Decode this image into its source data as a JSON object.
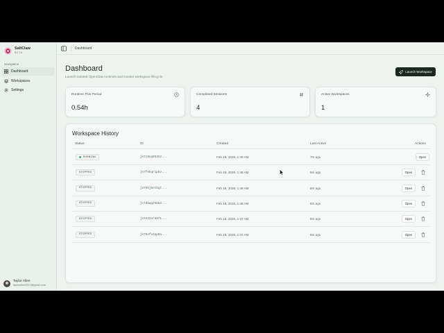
{
  "brand": {
    "name": "SaltClaw",
    "tag": "BETA"
  },
  "sidebar": {
    "section_label": "Navigation",
    "items": [
      {
        "label": "Dashboard",
        "icon": "dashboard-icon",
        "active": true
      },
      {
        "label": "Workspaces",
        "icon": "layers-icon",
        "active": false
      },
      {
        "label": "Settings",
        "icon": "gear-icon",
        "active": false
      }
    ]
  },
  "user": {
    "name": "Taylor Allen",
    "email": "taylorallen0912@gmail.com"
  },
  "topbar": {
    "breadcrumb": "Dashboard",
    "toggle_icon": "sidebar-toggle-icon"
  },
  "page": {
    "title": "Dashboard",
    "subtitle": "Launch isolated OpenClaw runtimes and monitor workspace lifecycle.",
    "launch_label": "Launch Workspace"
  },
  "stats": [
    {
      "label": "Runtime This Period",
      "value": "0.54h",
      "icon": "clock-icon"
    },
    {
      "label": "Completed Sessions",
      "value": "4",
      "icon": "hash-icon"
    },
    {
      "label": "Active Workspaces",
      "value": "1",
      "icon": "sparkle-icon"
    }
  ],
  "history": {
    "title": "Workspace History",
    "columns": [
      "Status",
      "ID",
      "Created",
      "Last Active",
      "Actions"
    ],
    "open_label": "Open",
    "rows": [
      {
        "status": "RUNNING",
        "id": "js7c6vq053n2...",
        "created": "Feb 18, 2026, 1:49 AM",
        "last_active": "7m ago",
        "deletable": false
      },
      {
        "status": "STOPPED",
        "id": "js7f6kqr1pkv...",
        "created": "Feb 18, 2026, 1:48 AM",
        "last_active": "8m ago",
        "deletable": true
      },
      {
        "status": "STOPPED",
        "id": "js79kj5ntkqt...",
        "created": "Feb 18, 2026, 1:48 AM",
        "last_active": "8m ago",
        "deletable": true
      },
      {
        "status": "STOPPED",
        "id": "js7d5qqz56ke...",
        "created": "Feb 18, 2026, 1:48 AM",
        "last_active": "8m ago",
        "deletable": true
      },
      {
        "status": "STOPPED",
        "id": "js7e22vra571...",
        "created": "Feb 18, 2026, 1:47 AM",
        "last_active": "8m ago",
        "deletable": true
      },
      {
        "status": "STOPPED",
        "id": "js79sfv2pp9a...",
        "created": "Feb 18, 2026, 1:47 AM",
        "last_active": "8m ago",
        "deletable": true
      }
    ]
  },
  "colors": {
    "accent": "#1c2722",
    "running": "#3fae6e",
    "background": "#eef3f0",
    "brand": "#c2185b"
  }
}
